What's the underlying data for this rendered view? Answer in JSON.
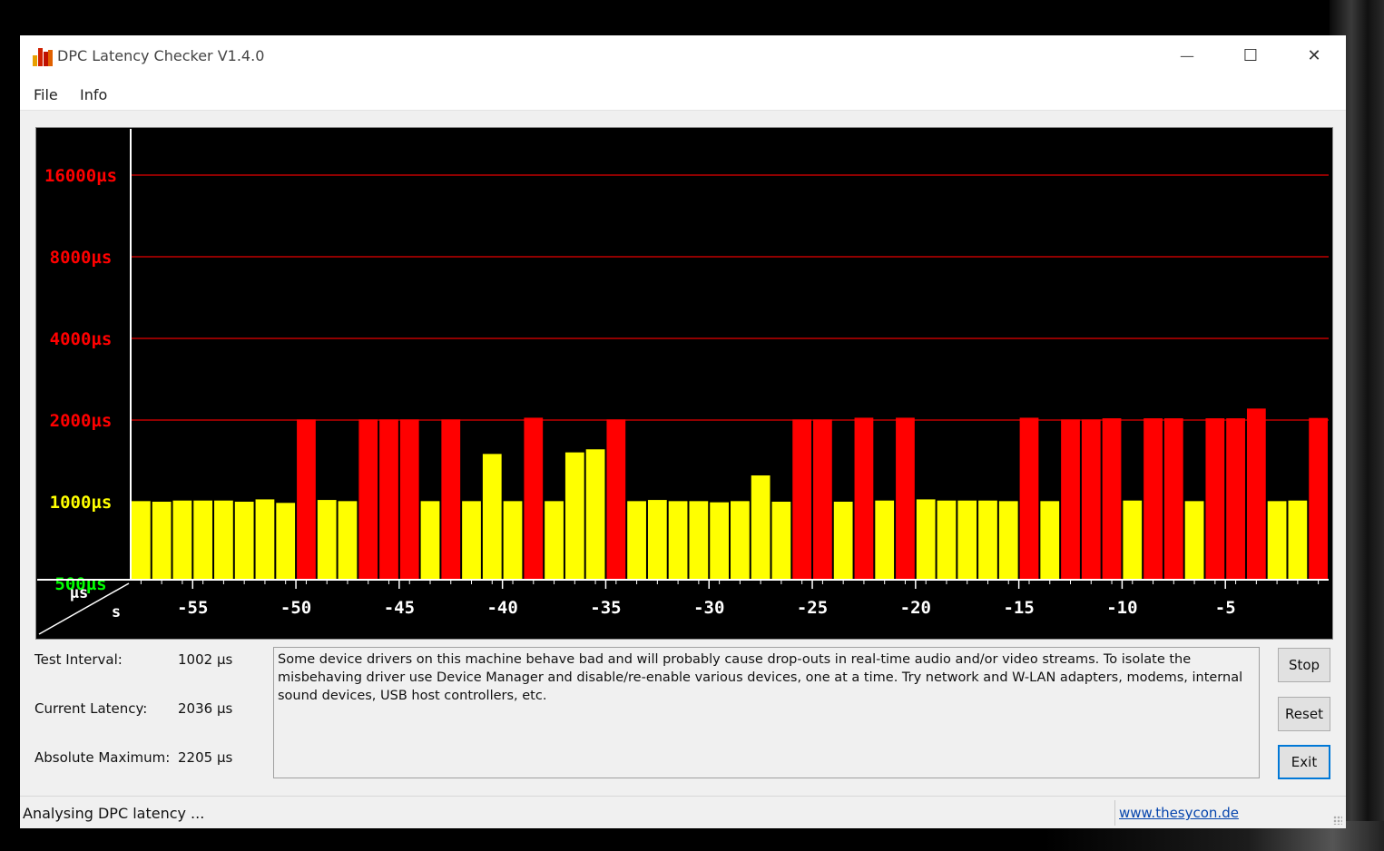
{
  "window": {
    "title": "DPC Latency Checker V1.4.0",
    "minimize_glyph": "—",
    "maximize_glyph": "☐",
    "close_glyph": "✕",
    "icon": "bar-chart-app-icon"
  },
  "menu": [
    {
      "label": "File"
    },
    {
      "label": "Info"
    }
  ],
  "chart_data": {
    "type": "bar",
    "y_scale": "log",
    "y_unit": "µs",
    "x_unit": "s",
    "y_ticks": [
      {
        "label": "16000µs",
        "value": 16000,
        "color": "#ff0000"
      },
      {
        "label": "8000µs",
        "value": 8000,
        "color": "#ff0000"
      },
      {
        "label": "4000µs",
        "value": 4000,
        "color": "#ff0000"
      },
      {
        "label": "2000µs",
        "value": 2000,
        "color": "#ff0000"
      },
      {
        "label": "1000µs",
        "value": 1000,
        "color": "#ffff00"
      },
      {
        "label": "500µs",
        "value": 500,
        "color": "#00ff00"
      }
    ],
    "x_ticks": [
      -55,
      -50,
      -45,
      -40,
      -35,
      -30,
      -25,
      -20,
      -15,
      -10,
      -5
    ],
    "corner_labels": {
      "y": "µs",
      "x": "s"
    },
    "threshold_colors": {
      "ok": "#ffff00",
      "warn": "#ff0000"
    },
    "bars": [
      1005,
      1000,
      1010,
      1010,
      1010,
      1000,
      1020,
      990,
      2010,
      1015,
      1005,
      2010,
      2010,
      2010,
      1005,
      2010,
      1005,
      1500,
      1005,
      2040,
      1005,
      1520,
      1560,
      2010,
      1005,
      1015,
      1005,
      1005,
      995,
      1005,
      1250,
      1000,
      2010,
      2010,
      1000,
      2040,
      1010,
      2040,
      1020,
      1010,
      1010,
      1010,
      1005,
      2040,
      1005,
      2010,
      2010,
      2030,
      1010,
      2030,
      2030,
      1005,
      2030,
      2030,
      2205,
      1005,
      1010,
      2036
    ]
  },
  "stats": [
    {
      "label": "Test Interval:",
      "value": "1002 µs"
    },
    {
      "label": "Current Latency:",
      "value": "2036 µs"
    },
    {
      "label": "Absolute Maximum:",
      "value": "2205 µs"
    }
  ],
  "message": "Some device drivers on this machine behave bad and will probably cause drop-outs in real-time audio and/or video streams. To isolate the misbehaving driver use Device Manager and disable/re-enable various devices, one at a time. Try network and W-LAN adapters, modems, internal sound devices, USB host controllers, etc.",
  "buttons": {
    "stop": "Stop",
    "reset": "Reset",
    "exit": "Exit"
  },
  "status": {
    "text": "Analysing DPC latency ...",
    "link": "www.thesycon.de"
  }
}
